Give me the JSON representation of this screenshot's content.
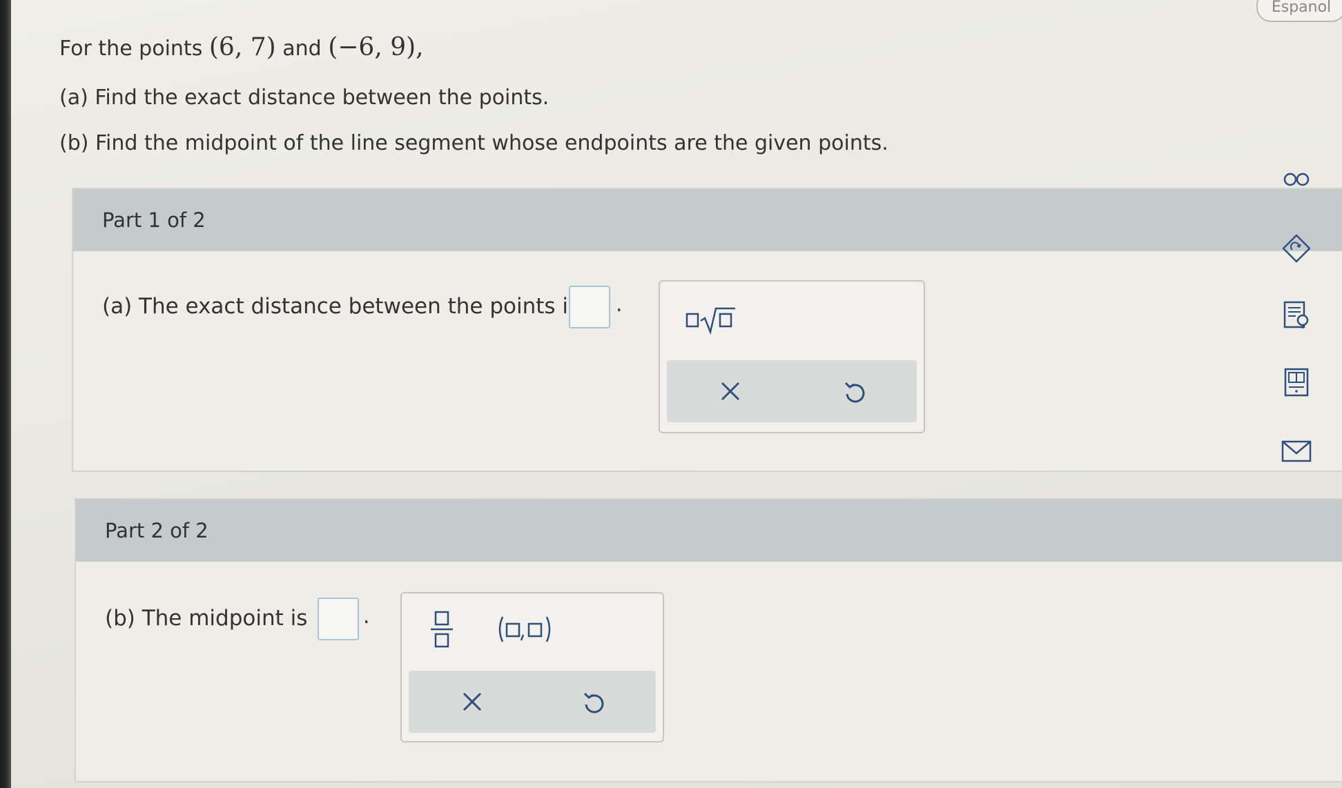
{
  "language_button": "Espanol",
  "question": {
    "intro_prefix": "For the points",
    "point1": "(6, 7)",
    "connector": "and",
    "point2": "(−6, 9),",
    "part_a": "(a) Find the exact distance between the points.",
    "part_b": "(b) Find the midpoint of the line segment whose endpoints are the given points."
  },
  "part1": {
    "header": "Part 1 of 2",
    "statement": "(a) The exact distance between the points is",
    "period": "."
  },
  "part2": {
    "header": "Part 2 of 2",
    "statement": "(b) The midpoint is",
    "period": "."
  },
  "palette1_tools": [
    "sqrt-template-icon",
    "clear-icon",
    "undo-icon"
  ],
  "palette2_tools": [
    "fraction-template-icon",
    "ordered-pair-template-icon",
    "clear-icon",
    "undo-icon"
  ],
  "sidebar_icons": [
    "glasses-icon",
    "tag-icon",
    "textbook-icon",
    "calculator-icon",
    "mail-icon"
  ],
  "colors": {
    "header_bg": "#c4cbca",
    "answer_border": "#a9c7d2",
    "icon_color": "#2f4f7a"
  }
}
